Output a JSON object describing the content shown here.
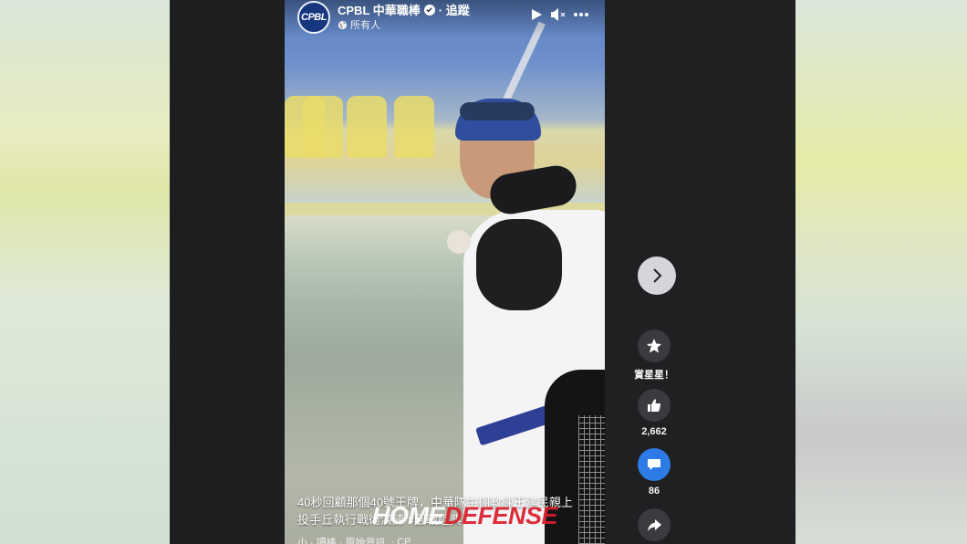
{
  "post": {
    "page_name": "CPBL 中華職棒",
    "follow_label": "· 追蹤",
    "audience": "所有人",
    "avatar_text": "CPBL"
  },
  "caption": {
    "line1": "40秒回顧那個40號王牌，中華隊牛棚教練王建民親上",
    "line2": "投手丘執行戰術演練 #回戰經典",
    "audio": "小 · 讀棒 · 原始音訊",
    "audio_tail": "· CP"
  },
  "watermark": {
    "part1": "HOME",
    "part2": "DEFENSE"
  },
  "actions": {
    "stars_label": "賞星星！",
    "like_count": "2,662",
    "comment_count": "86"
  },
  "icons": {
    "play": "play-icon",
    "mute": "mute-icon",
    "more": "more-icon",
    "next": "chevron-right-icon",
    "star": "star-icon",
    "like": "thumbs-up-icon",
    "comment": "comment-icon",
    "share": "share-icon"
  },
  "colors": {
    "brand_blue": "#16367e",
    "comment_blue": "#2d7be6",
    "watermark_red": "#d91e2a"
  }
}
